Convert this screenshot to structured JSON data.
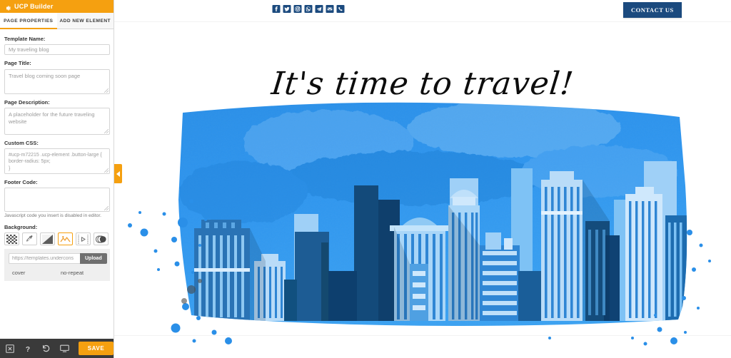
{
  "app": {
    "brand_title": "UCP Builder",
    "brand_icon": "gear-icon",
    "accent_color": "#f5a010",
    "sidebar_bg": "#ffffff",
    "bottombar_color": "#3a3a3a"
  },
  "tabs": [
    {
      "label": "PAGE PROPERTIES",
      "active": true
    },
    {
      "label": "ADD NEW ELEMENT",
      "active": false
    }
  ],
  "panel": {
    "template_name": {
      "label": "Template Name:",
      "value": "My traveling blog"
    },
    "page_title": {
      "label": "Page Title:",
      "value": "Travel blog coming soon page"
    },
    "page_description": {
      "label": "Page Description:",
      "value": "A placeholder for the future traveling website"
    },
    "custom_css": {
      "label": "Custom CSS:",
      "value": "#ucp-m72215 .ucp-element .button-large {\nborder-radius: 5px;\n}"
    },
    "footer_code": {
      "label": "Footer Code:",
      "value": "",
      "hint": "Javascript code you insert is disabled in editor."
    },
    "background": {
      "label": "Background:",
      "icons": [
        {
          "name": "transparent-checker-icon",
          "selected": false
        },
        {
          "name": "eyedropper-color-icon",
          "selected": false
        },
        {
          "name": "gradient-icon",
          "selected": false
        },
        {
          "name": "image-icon",
          "selected": true
        },
        {
          "name": "video-icon",
          "selected": false
        },
        {
          "name": "pattern-icon",
          "selected": false
        }
      ],
      "url_value": "https://templates.undercons",
      "upload_label": "Upload",
      "size_value": "cover",
      "repeat_value": "no-repeat"
    }
  },
  "bottombar": {
    "icons": [
      {
        "name": "close-icon"
      },
      {
        "name": "help-icon"
      },
      {
        "name": "undo-history-icon"
      },
      {
        "name": "desktop-preview-icon"
      }
    ],
    "save_label": "SAVE"
  },
  "collapse_handle": {
    "name": "collapse-sidebar-handle",
    "direction": "left"
  },
  "canvas": {
    "social_icons": [
      {
        "name": "facebook-icon"
      },
      {
        "name": "twitter-icon"
      },
      {
        "name": "instagram-icon"
      },
      {
        "name": "whatsapp-icon"
      },
      {
        "name": "telegram-icon"
      },
      {
        "name": "email-icon"
      },
      {
        "name": "phone-icon"
      }
    ],
    "social_color": "#1b4a7e",
    "contact_button": "CONTACT US",
    "contact_color": "#1b4a7e",
    "headline": "It's time to travel!",
    "hero_image": "watercolor-blue-cityscape"
  }
}
